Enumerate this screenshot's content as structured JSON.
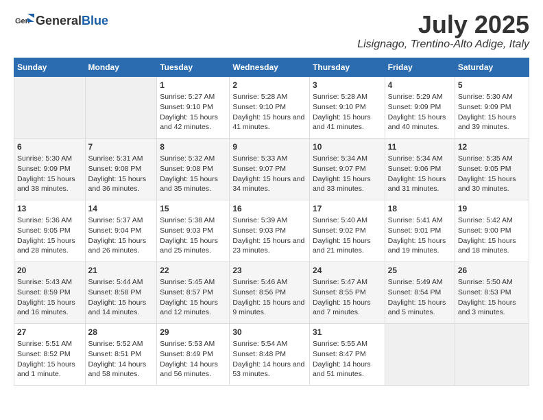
{
  "header": {
    "logo_general": "General",
    "logo_blue": "Blue",
    "month": "July 2025",
    "location": "Lisignago, Trentino-Alto Adige, Italy"
  },
  "days_of_week": [
    "Sunday",
    "Monday",
    "Tuesday",
    "Wednesday",
    "Thursday",
    "Friday",
    "Saturday"
  ],
  "weeks": [
    [
      {
        "day": "",
        "empty": true
      },
      {
        "day": "",
        "empty": true
      },
      {
        "day": "1",
        "sunrise": "5:27 AM",
        "sunset": "9:10 PM",
        "daylight": "15 hours and 42 minutes."
      },
      {
        "day": "2",
        "sunrise": "5:28 AM",
        "sunset": "9:10 PM",
        "daylight": "15 hours and 41 minutes."
      },
      {
        "day": "3",
        "sunrise": "5:28 AM",
        "sunset": "9:10 PM",
        "daylight": "15 hours and 41 minutes."
      },
      {
        "day": "4",
        "sunrise": "5:29 AM",
        "sunset": "9:09 PM",
        "daylight": "15 hours and 40 minutes."
      },
      {
        "day": "5",
        "sunrise": "5:30 AM",
        "sunset": "9:09 PM",
        "daylight": "15 hours and 39 minutes."
      }
    ],
    [
      {
        "day": "6",
        "sunrise": "5:30 AM",
        "sunset": "9:09 PM",
        "daylight": "15 hours and 38 minutes."
      },
      {
        "day": "7",
        "sunrise": "5:31 AM",
        "sunset": "9:08 PM",
        "daylight": "15 hours and 36 minutes."
      },
      {
        "day": "8",
        "sunrise": "5:32 AM",
        "sunset": "9:08 PM",
        "daylight": "15 hours and 35 minutes."
      },
      {
        "day": "9",
        "sunrise": "5:33 AM",
        "sunset": "9:07 PM",
        "daylight": "15 hours and 34 minutes."
      },
      {
        "day": "10",
        "sunrise": "5:34 AM",
        "sunset": "9:07 PM",
        "daylight": "15 hours and 33 minutes."
      },
      {
        "day": "11",
        "sunrise": "5:34 AM",
        "sunset": "9:06 PM",
        "daylight": "15 hours and 31 minutes."
      },
      {
        "day": "12",
        "sunrise": "5:35 AM",
        "sunset": "9:05 PM",
        "daylight": "15 hours and 30 minutes."
      }
    ],
    [
      {
        "day": "13",
        "sunrise": "5:36 AM",
        "sunset": "9:05 PM",
        "daylight": "15 hours and 28 minutes."
      },
      {
        "day": "14",
        "sunrise": "5:37 AM",
        "sunset": "9:04 PM",
        "daylight": "15 hours and 26 minutes."
      },
      {
        "day": "15",
        "sunrise": "5:38 AM",
        "sunset": "9:03 PM",
        "daylight": "15 hours and 25 minutes."
      },
      {
        "day": "16",
        "sunrise": "5:39 AM",
        "sunset": "9:03 PM",
        "daylight": "15 hours and 23 minutes."
      },
      {
        "day": "17",
        "sunrise": "5:40 AM",
        "sunset": "9:02 PM",
        "daylight": "15 hours and 21 minutes."
      },
      {
        "day": "18",
        "sunrise": "5:41 AM",
        "sunset": "9:01 PM",
        "daylight": "15 hours and 19 minutes."
      },
      {
        "day": "19",
        "sunrise": "5:42 AM",
        "sunset": "9:00 PM",
        "daylight": "15 hours and 18 minutes."
      }
    ],
    [
      {
        "day": "20",
        "sunrise": "5:43 AM",
        "sunset": "8:59 PM",
        "daylight": "15 hours and 16 minutes."
      },
      {
        "day": "21",
        "sunrise": "5:44 AM",
        "sunset": "8:58 PM",
        "daylight": "15 hours and 14 minutes."
      },
      {
        "day": "22",
        "sunrise": "5:45 AM",
        "sunset": "8:57 PM",
        "daylight": "15 hours and 12 minutes."
      },
      {
        "day": "23",
        "sunrise": "5:46 AM",
        "sunset": "8:56 PM",
        "daylight": "15 hours and 9 minutes."
      },
      {
        "day": "24",
        "sunrise": "5:47 AM",
        "sunset": "8:55 PM",
        "daylight": "15 hours and 7 minutes."
      },
      {
        "day": "25",
        "sunrise": "5:49 AM",
        "sunset": "8:54 PM",
        "daylight": "15 hours and 5 minutes."
      },
      {
        "day": "26",
        "sunrise": "5:50 AM",
        "sunset": "8:53 PM",
        "daylight": "15 hours and 3 minutes."
      }
    ],
    [
      {
        "day": "27",
        "sunrise": "5:51 AM",
        "sunset": "8:52 PM",
        "daylight": "15 hours and 1 minute."
      },
      {
        "day": "28",
        "sunrise": "5:52 AM",
        "sunset": "8:51 PM",
        "daylight": "14 hours and 58 minutes."
      },
      {
        "day": "29",
        "sunrise": "5:53 AM",
        "sunset": "8:49 PM",
        "daylight": "14 hours and 56 minutes."
      },
      {
        "day": "30",
        "sunrise": "5:54 AM",
        "sunset": "8:48 PM",
        "daylight": "14 hours and 53 minutes."
      },
      {
        "day": "31",
        "sunrise": "5:55 AM",
        "sunset": "8:47 PM",
        "daylight": "14 hours and 51 minutes."
      },
      {
        "day": "",
        "empty": true
      },
      {
        "day": "",
        "empty": true
      }
    ]
  ]
}
